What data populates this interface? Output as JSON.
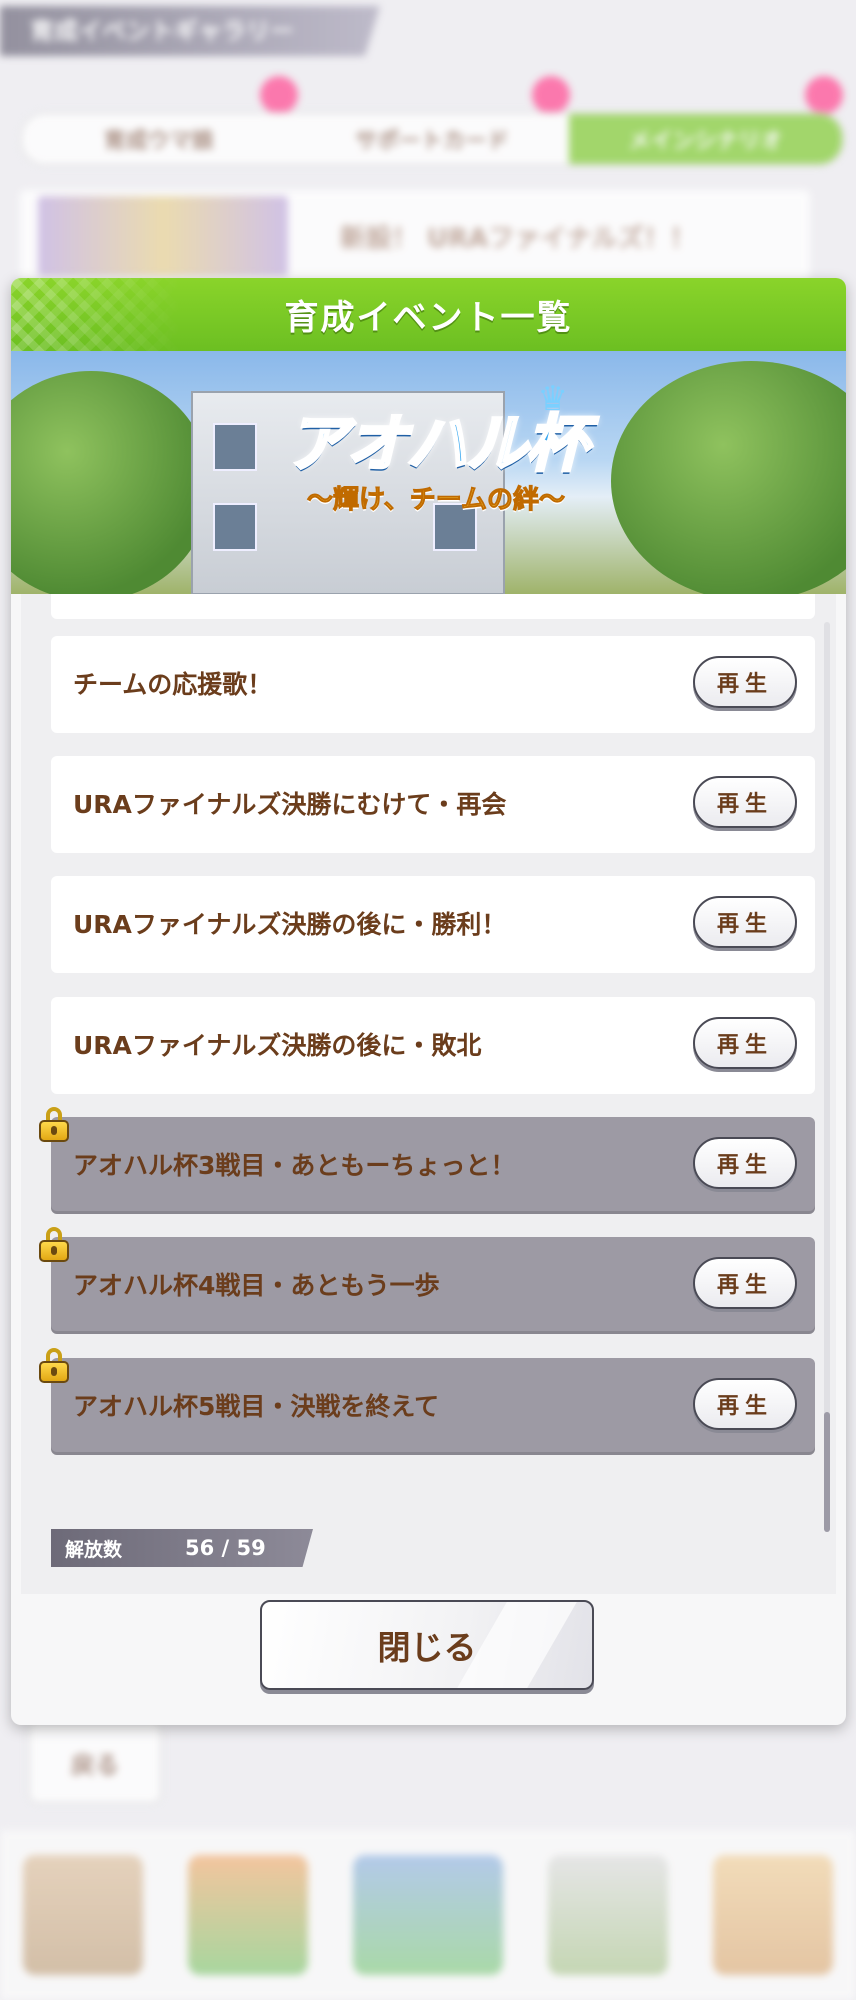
{
  "background": {
    "screen_title": "育成イベントギャラリー",
    "tabs": [
      "育成ウマ娘",
      "サポートカード",
      "メインシナリオ"
    ],
    "row_text": "新設！ URAファイナルズ！！",
    "back_label": "戻る"
  },
  "dialog": {
    "title": "育成イベント一覧",
    "banner": {
      "logo_main": "アオハル杯",
      "logo_sub": "〜輝け、チームの絆〜"
    },
    "events": [
      {
        "title": "チームの応援歌！",
        "play_label": "再生",
        "locked": false
      },
      {
        "title": "URAファイナルズ決勝にむけて・再会",
        "play_label": "再生",
        "locked": false
      },
      {
        "title": "URAファイナルズ決勝の後に・勝利！",
        "play_label": "再生",
        "locked": false
      },
      {
        "title": "URAファイナルズ決勝の後に・敗北",
        "play_label": "再生",
        "locked": false
      },
      {
        "title": "アオハル杯3戦目・あともーちょっと！",
        "play_label": "再生",
        "locked": true
      },
      {
        "title": "アオハル杯4戦目・あともう一歩",
        "play_label": "再生",
        "locked": true
      },
      {
        "title": "アオハル杯5戦目・決戦を終えて",
        "play_label": "再生",
        "locked": true
      }
    ],
    "unlock": {
      "label": "解放数",
      "value": "56 /  59"
    },
    "close_label": "閉じる"
  },
  "colors": {
    "header_green": "#7cc825",
    "text_brown": "#6b3d1c",
    "locked_row": "#9d9aa4"
  }
}
